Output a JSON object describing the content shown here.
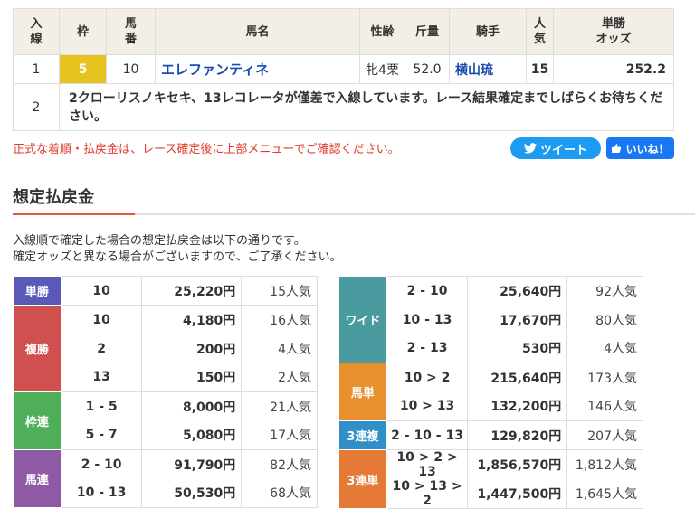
{
  "result": {
    "headers": {
      "rank": "入\n線",
      "frame": "枠",
      "num": "馬\n番",
      "name": "馬名",
      "sexage": "性齢",
      "weight": "斤量",
      "jockey": "騎手",
      "pop": "人\n気",
      "odds": "単勝\nオッズ"
    },
    "row1": {
      "rank": "1",
      "frame": "5",
      "num": "10",
      "name": "エレファンティネ",
      "sexage": "牝4栗",
      "weight": "52.0",
      "jockey": "横山琉",
      "pop": "15",
      "odds": "252.2"
    },
    "row2": {
      "rank": "2",
      "note": "2クローリスノキセキ、13レコレータが僅差で入線しています。レース結果確定までしばらくお待ちください。"
    }
  },
  "warning": "正式な着順・払戻金は、レース確定後に上部メニューでご確認ください。",
  "tweet_label": "ツイート",
  "like_label": "いいね！",
  "section_title": "想定払戻金",
  "intro_line1": "入線順で確定した場合の想定払戻金は以下の通りです。",
  "intro_line2": "確定オッズと異なる場合がございますので、ご了承ください。",
  "colors": {
    "tansho": "#5a58b8",
    "fukusho": "#d05050",
    "wakuren": "#4fae5a",
    "umaren": "#8e5aa6",
    "wide": "#4a9ba0",
    "umatan": "#e9902e",
    "sanrenpuku": "#2f8fc6",
    "sanrentan": "#e57a36",
    "frame5": "#e6c31f"
  },
  "left": {
    "tansho": {
      "label": "単勝",
      "rows": [
        {
          "comb": "10",
          "amt": "25,220円",
          "pop": "15人気"
        }
      ]
    },
    "fukusho": {
      "label": "複勝",
      "rows": [
        {
          "comb": "10",
          "amt": "4,180円",
          "pop": "16人気"
        },
        {
          "comb": "2",
          "amt": "200円",
          "pop": "4人気"
        },
        {
          "comb": "13",
          "amt": "150円",
          "pop": "2人気"
        }
      ]
    },
    "wakuren": {
      "label": "枠連",
      "rows": [
        {
          "comb": "1 - 5",
          "amt": "8,000円",
          "pop": "21人気"
        },
        {
          "comb": "5 - 7",
          "amt": "5,080円",
          "pop": "17人気"
        }
      ]
    },
    "umaren": {
      "label": "馬連",
      "rows": [
        {
          "comb": "2 - 10",
          "amt": "91,790円",
          "pop": "82人気"
        },
        {
          "comb": "10 - 13",
          "amt": "50,530円",
          "pop": "68人気"
        }
      ]
    }
  },
  "right": {
    "wide": {
      "label": "ワイド",
      "rows": [
        {
          "comb": "2 - 10",
          "amt": "25,640円",
          "pop": "92人気"
        },
        {
          "comb": "10 - 13",
          "amt": "17,670円",
          "pop": "80人気"
        },
        {
          "comb": "2 - 13",
          "amt": "530円",
          "pop": "4人気"
        }
      ]
    },
    "umatan": {
      "label": "馬単",
      "rows": [
        {
          "comb": "10 > 2",
          "amt": "215,640円",
          "pop": "173人気"
        },
        {
          "comb": "10 > 13",
          "amt": "132,200円",
          "pop": "146人気"
        }
      ]
    },
    "sanrenpuku": {
      "label": "3連複",
      "rows": [
        {
          "comb": "2 - 10 - 13",
          "amt": "129,820円",
          "pop": "207人気"
        }
      ]
    },
    "sanrentan": {
      "label": "3連単",
      "rows": [
        {
          "comb": "10 > 2 > 13",
          "amt": "1,856,570円",
          "pop": "1,812人気"
        },
        {
          "comb": "10 > 13 > 2",
          "amt": "1,447,500円",
          "pop": "1,645人気"
        }
      ]
    }
  }
}
